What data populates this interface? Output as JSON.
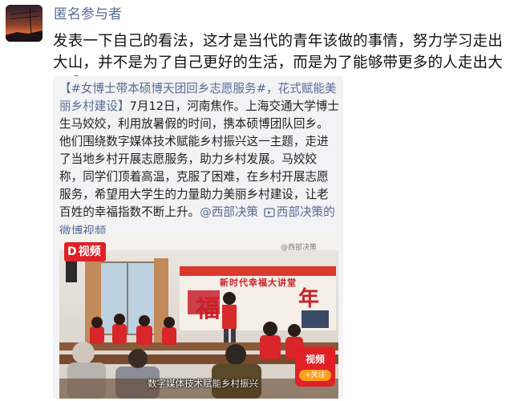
{
  "post": {
    "username": "匿名参与者",
    "text": "发表一下自己的看法，这才是当代的青年该做的事情，努力学习走出大山，并不是为了自己更好的生活，而是为了能够带更多的人走出大山",
    "emoji_icon": "rose-icon"
  },
  "shared": {
    "hashtag": "【#女博士带本硕博天团回乡志愿服务#，花式赋能美丽乡村建设】",
    "body": "7月12日，河南焦作。上海交通大学博士生马姣姣，利用放暑假的时间，携本硕博团队回乡。他们围绕数字媒体技术赋能乡村振兴这一主题，走进了当地乡村开展志愿服务，助力乡村发展。马姣姣称，同学们顶着高温，克服了困难，在乡村开展志愿服务，希望用大学生的力量助力美丽乡村建设，让老百姓的幸福指数不断上升。",
    "mention": "@西部决策",
    "video_link": "西部决策的微博视频"
  },
  "video": {
    "logo_label": "视频",
    "watermark": "@西部决策",
    "banner": "新时代幸福大讲堂",
    "char1": "福",
    "char2": "年",
    "badge_title": "视频",
    "badge_follow": "+关注",
    "caption": "数字媒体技术赋能乡村振兴"
  },
  "colors": {
    "link": "#576b95",
    "card_bg": "#f3f3f5",
    "video_red": "#e02025"
  }
}
